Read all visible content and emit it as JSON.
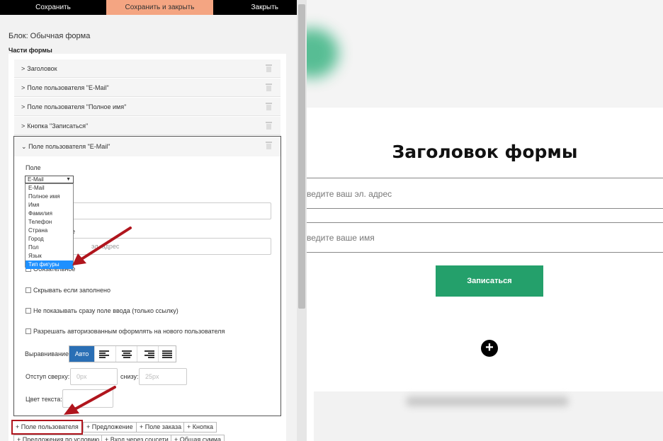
{
  "topbar": {
    "save": "Сохранить",
    "save_close": "Сохранить и закрыть",
    "close": "Закрыть"
  },
  "editor": {
    "block_title": "Блок: Обычная форма",
    "parts_title": "Части формы",
    "collapsed": [
      "Заголовок",
      "Поле пользователя \"E-Mail\"",
      "Поле пользователя \"Полное имя\"",
      "Кнопка \"Записаться\""
    ],
    "open_title": "Поле пользователя \"E-Mail\"",
    "field_label": "Поле",
    "field_selected": "E-Mail",
    "field_options": [
      "E-Mail",
      "Полное имя",
      "Имя",
      "Фамилия",
      "Телефон",
      "Страна",
      "Город",
      "Пол",
      "Язык",
      "Тип фигуры"
    ],
    "field_options_highlighted": "Тип фигуры",
    "hint_label_tail": "е",
    "placeholder_value_tail": "эл. адрес",
    "required_label": "Обязательное",
    "hide_filled_label": "Скрывать если заполнено",
    "no_input_label": "Не показывать сразу поле ввода (только ссылку)",
    "allow_auth_label": "Разрешать авторизованным оформлять на нового пользователя",
    "align_label": "Выравнивание",
    "align_auto": "Авто",
    "margin_top_label": "Отступ сверху:",
    "margin_top_placeholder": "0px",
    "margin_bottom_label": "снизу:",
    "margin_bottom_placeholder": "25px",
    "text_color_label": "Цвет текста:"
  },
  "add_buttons": {
    "row1": [
      "+ Поле пользователя",
      "+ Предложение",
      "+ Поле заказа",
      "+ Кнопка"
    ],
    "row2": [
      "+ Предложения по условию",
      "+ Вход через соцсети",
      "+ Общая сумма"
    ]
  },
  "preview": {
    "form_title": "Заголовок формы",
    "email_placeholder": "ведите ваш эл. адрес",
    "name_placeholder": "ведите ваше имя",
    "submit": "Записаться",
    "add_icon": "+"
  },
  "colors": {
    "accent": "#f4a582",
    "submit_green": "#24a06b",
    "highlight_red": "#b0151d",
    "auto_blue": "#2a6fb5"
  }
}
